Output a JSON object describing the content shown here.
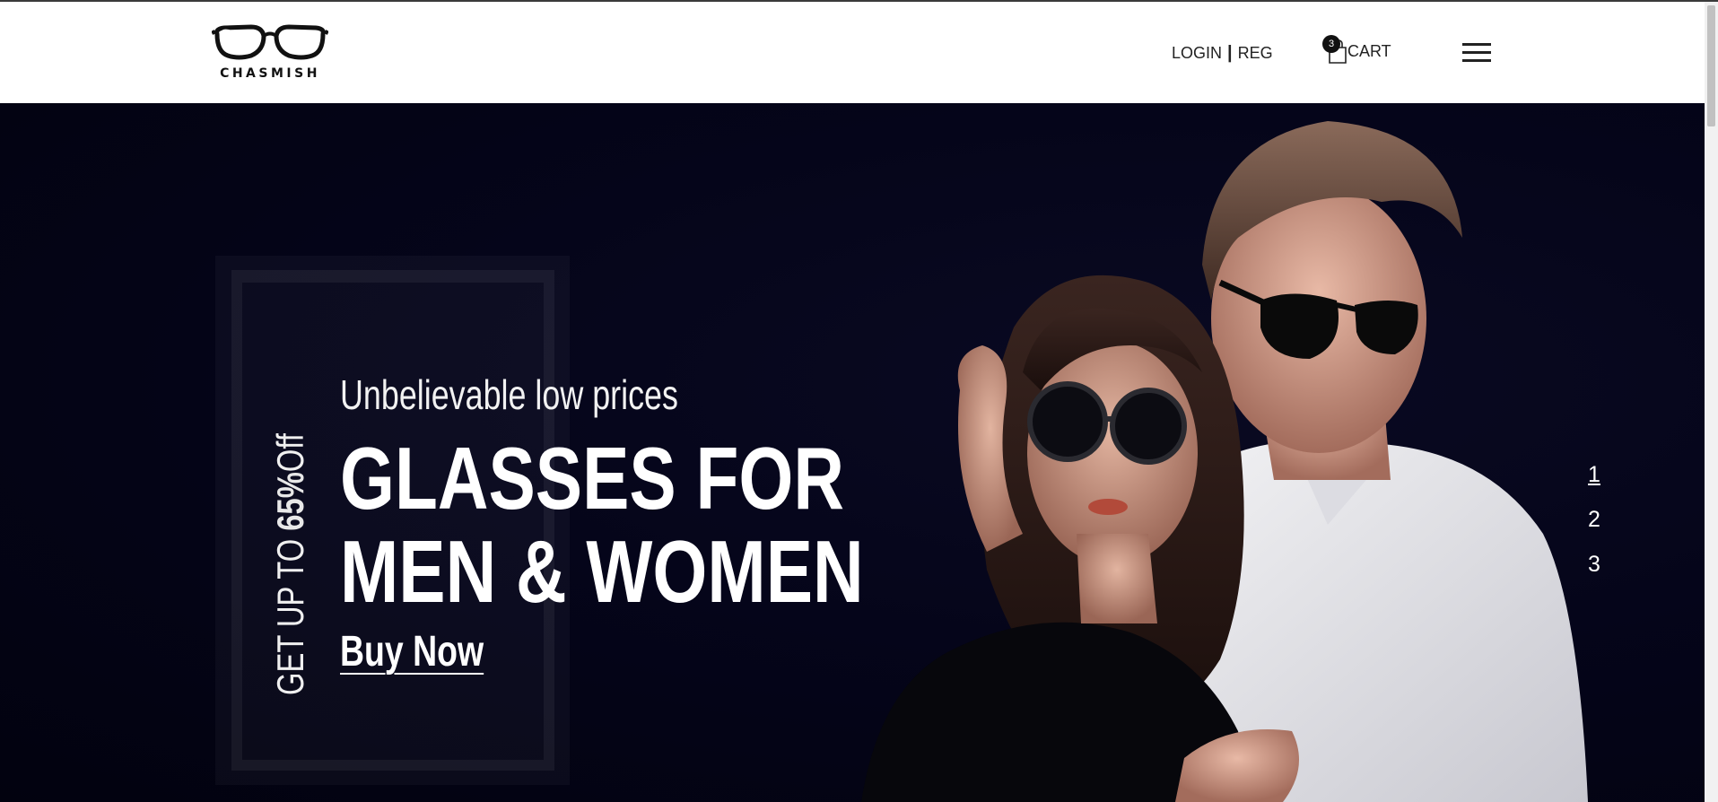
{
  "brand": {
    "name": "CHASMISH"
  },
  "header": {
    "login_label": "LOGIN",
    "separator": "|",
    "register_label": "REG",
    "cart_label": "CART",
    "cart_count": "3"
  },
  "hero": {
    "side_text_prefix": "GET UP TO ",
    "side_text_highlight": "65%",
    "side_text_suffix": "Off",
    "tagline": "Unbelievable low prices",
    "headline_line1": "GLASSES FOR",
    "headline_line2": "MEN & WOMEN",
    "cta_label": "Buy Now",
    "pager": [
      "1",
      "2",
      "3"
    ]
  },
  "colors": {
    "hero_background": "#03031a",
    "header_background": "#ffffff",
    "text_light": "#ffffff"
  }
}
